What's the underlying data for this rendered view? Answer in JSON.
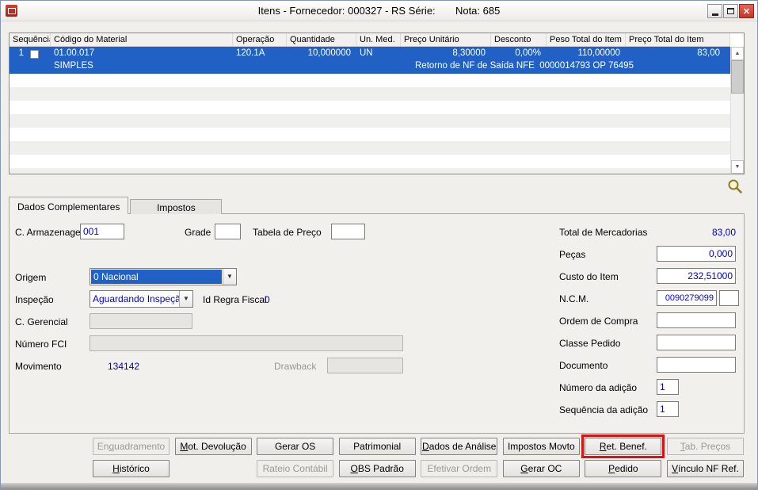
{
  "window": {
    "title": "Itens - Fornecedor: 000327 - RS Série:       Nota: 685",
    "close_glyph": "✕"
  },
  "icons": {
    "scroll_up": "▲",
    "scroll_down": "▼",
    "combo_arrow": "▼"
  },
  "grid": {
    "columns": [
      "Sequência",
      "Código do Material",
      "Operação",
      "Quantidade",
      "Un. Med.",
      "Preço Unitário",
      "Desconto",
      "Peso Total do Item",
      "Preço Total do Item"
    ],
    "row": {
      "sequencia": "1",
      "codigo_material": "01.00.017",
      "material_desc": "SIMPLES",
      "operacao": "120.1A",
      "quantidade": "10,000000",
      "unidade": "UN",
      "preco_unitario": "8,30000",
      "desconto": "0,00%",
      "peso_total": "110,00000",
      "preco_total": "83,00",
      "observacao": "Retorno de NF de Saída NFE  0000014793 OP 76495"
    }
  },
  "tabs": {
    "dados": "Dados Complementares",
    "impostos": "Impostos"
  },
  "fields": {
    "c_armazenagem": {
      "label": "C. Armazenagem",
      "value": "001"
    },
    "grade": {
      "label": "Grade",
      "value": ""
    },
    "tabela_preco": {
      "label": "Tabela de Preço",
      "value": ""
    },
    "origem": {
      "label": "Origem",
      "value": "0 Nacional"
    },
    "inspecao": {
      "label": "Inspeção",
      "value": "Aguardando Inspeção"
    },
    "id_regra_fiscal": {
      "label": "Id Regra Fiscal",
      "value": "0"
    },
    "c_gerencial": {
      "label": "C. Gerencial",
      "value": ""
    },
    "numero_fci": {
      "label": "Número FCI",
      "value": ""
    },
    "movimento": {
      "label": "Movimento",
      "value": "134142"
    },
    "drawback": {
      "label": "Drawback",
      "value": ""
    },
    "total_mercadorias": {
      "label": "Total de Mercadorias",
      "value": "83,00"
    },
    "pecas": {
      "label": "Peças",
      "value": "0,000"
    },
    "custo_item": {
      "label": "Custo do Item",
      "value": "232,51000"
    },
    "ncm": {
      "label": "N.C.M.",
      "value": "0090279099",
      "value2": ""
    },
    "ordem_compra": {
      "label": "Ordem de Compra",
      "value": ""
    },
    "classe_pedido": {
      "label": "Classe Pedido",
      "value": ""
    },
    "documento": {
      "label": "Documento",
      "value": ""
    },
    "numero_adicao": {
      "label": "Número da adição",
      "value": "1"
    },
    "sequencia_adicao": {
      "label": "Sequência da adição",
      "value": "1"
    }
  },
  "buttons": {
    "row1": [
      {
        "label": "Enquadramento",
        "key": "q",
        "disabled": true
      },
      {
        "label": "Mot. Devolução",
        "key": "M"
      },
      {
        "label": "Gerar OS",
        "key": ""
      },
      {
        "label": "Patrimonial",
        "key": ""
      },
      {
        "label": "Dados de Análise",
        "key": "D"
      },
      {
        "label": "Impostos Movto",
        "key": ""
      },
      {
        "label": "Ret. Benef.",
        "key": "R",
        "highlighted": true
      },
      {
        "label": "Tab. Preços",
        "key": "T",
        "disabled": true
      }
    ],
    "row2": [
      {
        "label": "Histórico",
        "key": "H"
      },
      null,
      {
        "label": "Rateio Contábil",
        "key": "",
        "disabled": true
      },
      {
        "label": "OBS Padrão",
        "key": "O"
      },
      {
        "label": "Efetivar Ordem",
        "key": "",
        "disabled": true
      },
      {
        "label": "Gerar OC",
        "key": "G"
      },
      {
        "label": "Pedido",
        "key": "P"
      },
      {
        "label": "Vínculo NF Ref.",
        "key": "V"
      }
    ]
  },
  "colors": {
    "selection_blue": "#2160c4",
    "value_blue": "#0000c8",
    "annotation_red": "#dd1111"
  }
}
